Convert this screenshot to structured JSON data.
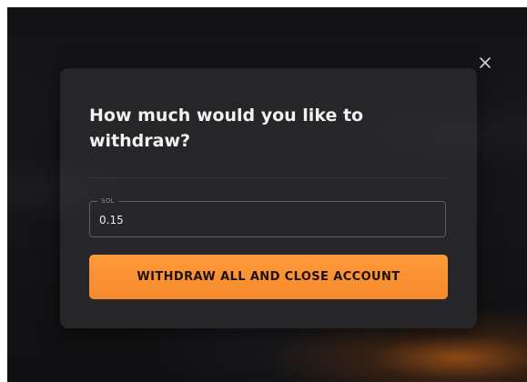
{
  "modal": {
    "title": "How much would you like to withdraw?",
    "amount_field": {
      "label": "SOL",
      "value": "0.15"
    },
    "withdraw_button_label": "WITHDRAW ALL AND CLOSE ACCOUNT",
    "close_icon": "close-icon"
  },
  "colors": {
    "modal_background": "#262629",
    "accent": "#f58a2c",
    "title_text": "#f1f1f1",
    "backdrop": "#141416"
  }
}
